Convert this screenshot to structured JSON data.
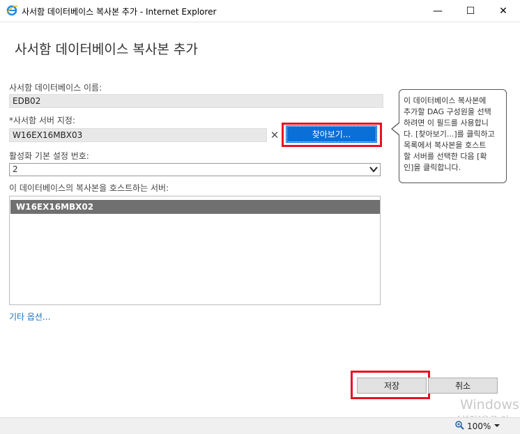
{
  "window": {
    "title": "사서함 데이터베이스 복사본 추가 - Internet Explorer",
    "minimize": "—",
    "maximize": "☐",
    "close": "✕"
  },
  "page": {
    "title": "사서함 데이터베이스 복사본 추가"
  },
  "form": {
    "db_name_label": "사서함 데이터베이스 이름:",
    "db_name_value": "EDB02",
    "server_label": "*사서함 서버 지정:",
    "server_value": "W16EX16MBX03",
    "clear_glyph": "✕",
    "browse_label": "찾아보기...",
    "activation_label": "활성화 기본 설정 번호:",
    "activation_value": "2",
    "hosts_label": "이 데이터베이스의 복사본을 호스트하는 서버:",
    "hosts": [
      "W16EX16MBX02"
    ],
    "more_options": "기타 옵션..."
  },
  "tooltip": {
    "lines": [
      "이 데이터베이스 복사본에",
      "추가할 DAG 구성원을 선택",
      "하려면 이 필드를 사용합니",
      "다. [찾아보기...]를 클릭하고",
      "목록에서 복사본을 호스트",
      "할 서버를 선택한 다음 [확",
      "인]을 클릭합니다."
    ]
  },
  "buttons": {
    "save": "저장",
    "cancel": "취소"
  },
  "watermark": {
    "line1": "Windows",
    "line2": "[설정]으로 이"
  },
  "status": {
    "zoom": "100%"
  },
  "colors": {
    "accent": "#0a6fd6",
    "highlight": "#e81123",
    "selected_row": "#707070"
  }
}
